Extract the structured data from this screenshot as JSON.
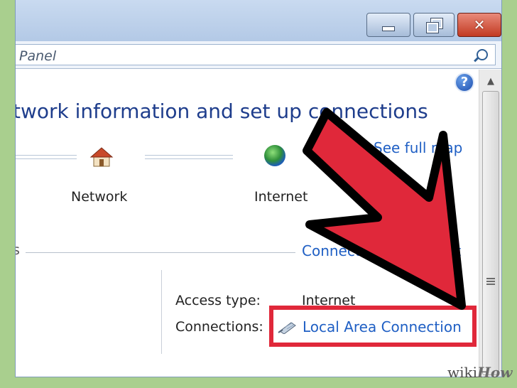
{
  "window": {
    "address": "Panel",
    "caption_buttons": {
      "minimize_icon": "minimize-icon",
      "maximize_icon": "restore-icon",
      "close_icon": "close-icon",
      "close_glyph": "✕"
    }
  },
  "help": {
    "glyph": "?"
  },
  "main": {
    "heading": "twork information and set up connections",
    "see_full_map": "See full map",
    "network_label": "Network",
    "internet_label": "Internet",
    "section_fragment": "s",
    "connect_disconnect": "Connect or disconnect",
    "access_type_label": "Access type:",
    "access_type_value": "Internet",
    "connections_label": "Connections:",
    "connection_link": "Local Area Connection"
  },
  "scrollbar": {
    "up_glyph": "▲"
  },
  "watermark": {
    "prefix": "wiki",
    "suffix": "How"
  },
  "colors": {
    "highlight": "#e0283a",
    "arrow_fill": "#e0283a",
    "link": "#1f5fc4",
    "heading": "#1e3d8c",
    "background": "#a9cf8e"
  }
}
